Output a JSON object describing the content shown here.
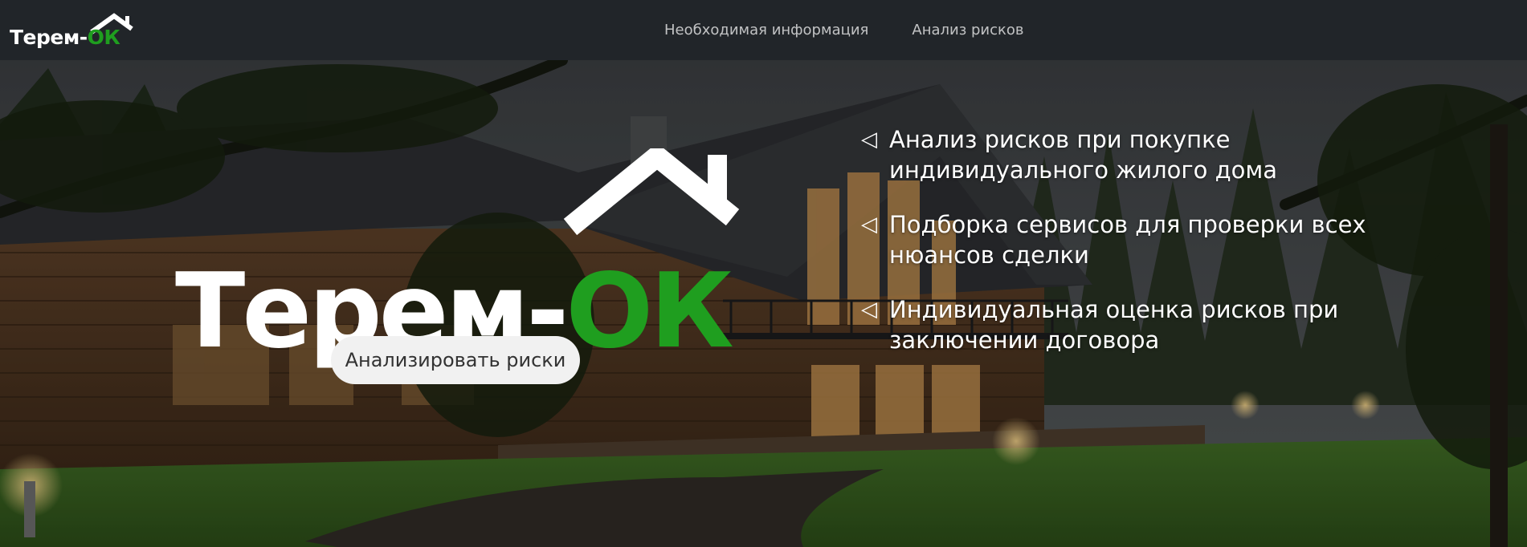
{
  "navbar": {
    "brand": {
      "text_main": "Терем-",
      "text_accent": "ОК"
    },
    "links": [
      "Необходимая информация",
      "Анализ рисков"
    ]
  },
  "hero": {
    "logo": {
      "text_main": "Терем-",
      "text_accent": "ОК"
    },
    "cta_label": "Анализировать риски",
    "features": [
      {
        "arrow": "◁",
        "text": "Анализ рисков при покупке индивидуального жилого дома"
      },
      {
        "arrow": "◁",
        "text": "Подборка сервисов для проверки всех нюансов сделки"
      },
      {
        "arrow": "◁",
        "text": "Индивидуальная оценка рисков при заключении договора"
      }
    ]
  },
  "colors": {
    "navbar_bg": "#212529",
    "brand_accent": "#1f9e1f",
    "button_bg": "#f1f1f1"
  },
  "icons": {
    "brand_roof": "house-roof-icon",
    "feature_bullet": "triangle-left-icon"
  }
}
